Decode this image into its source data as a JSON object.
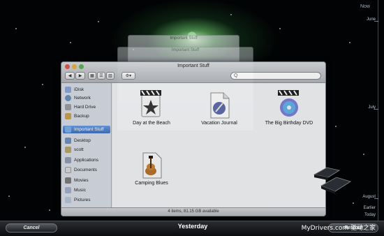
{
  "timeline": {
    "labels": [
      "June",
      "July",
      "August",
      "Earlier",
      "Today"
    ],
    "top_label": "Now"
  },
  "back_windows": [
    {
      "title": "Important Stuff"
    },
    {
      "title": "Important Stuff"
    }
  ],
  "window": {
    "title": "Important Stuff",
    "toolbar": {
      "back_label": "◀",
      "forward_label": "▶",
      "view_labels": [
        "▦",
        "☰",
        "▥"
      ],
      "action_label": "⚙▾",
      "search_placeholder": "Q"
    },
    "sidebar": {
      "items": [
        {
          "label": "iDisk",
          "icon": "idisk-icon",
          "color": "#8aa7d6"
        },
        {
          "label": "Network",
          "icon": "network-icon",
          "color": "#6b8fbf"
        },
        {
          "label": "Hard Drive",
          "icon": "hard-drive-icon",
          "color": "#9a9da3"
        },
        {
          "label": "Backup",
          "icon": "backup-drive-icon",
          "color": "#c9a24f"
        },
        {
          "label": "Important Stuff",
          "icon": "folder-icon",
          "color": "#7fb0e6",
          "selected": true
        },
        {
          "label": "Desktop",
          "icon": "desktop-icon",
          "color": "#6d8fc4"
        },
        {
          "label": "scott",
          "icon": "home-icon",
          "color": "#b8a36a"
        },
        {
          "label": "Applications",
          "icon": "applications-icon",
          "color": "#8f9db3"
        },
        {
          "label": "Documents",
          "icon": "documents-icon",
          "color": "#d9d9d9"
        },
        {
          "label": "Movies",
          "icon": "movies-icon",
          "color": "#7c7c7c"
        },
        {
          "label": "Music",
          "icon": "music-icon",
          "color": "#9fb0c9"
        },
        {
          "label": "Pictures",
          "icon": "pictures-icon",
          "color": "#b6c4d6"
        }
      ]
    },
    "files": [
      {
        "label": "Day at the Beach",
        "icon": "imovie-project-icon"
      },
      {
        "label": "Vacation  Journal",
        "icon": "pages-document-icon"
      },
      {
        "label": "The Big Birthday DVD",
        "icon": "idvd-project-icon"
      },
      {
        "label": "Camping Blues",
        "icon": "garageband-file-icon"
      }
    ],
    "status": "4 items, 81.15 GB available"
  },
  "bottom_bar": {
    "cancel_label": "Cancel",
    "date_label": "Yesterday",
    "restore_label": "Restore"
  },
  "watermark": "MyDrivers.com 驱动之家"
}
